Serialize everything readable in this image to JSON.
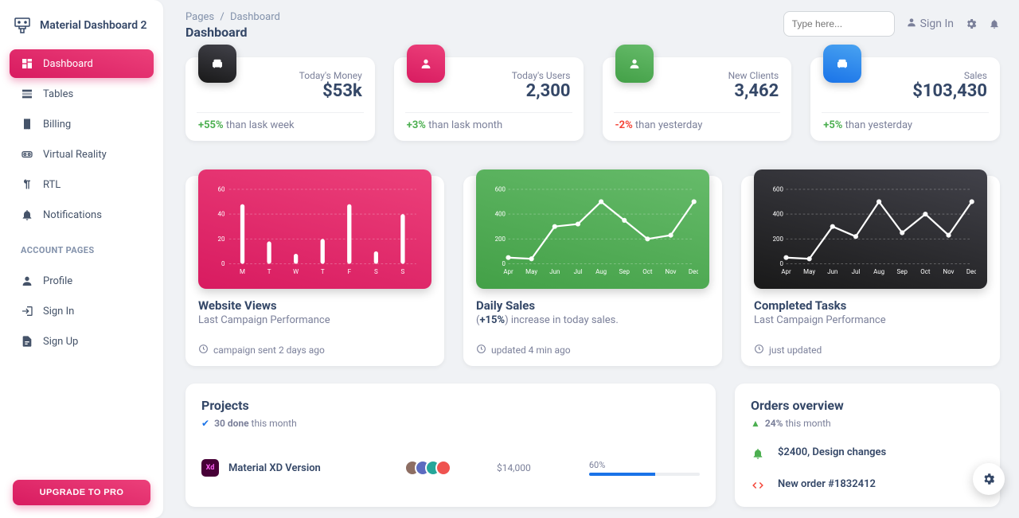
{
  "brand": "Material Dashboard 2",
  "nav": {
    "main": [
      {
        "label": "Dashboard",
        "icon": "dashboard",
        "active": true
      },
      {
        "label": "Tables",
        "icon": "table"
      },
      {
        "label": "Billing",
        "icon": "receipt"
      },
      {
        "label": "Virtual Reality",
        "icon": "vr"
      },
      {
        "label": "RTL",
        "icon": "rtl"
      },
      {
        "label": "Notifications",
        "icon": "bell"
      }
    ],
    "section_label": "ACCOUNT PAGES",
    "account": [
      {
        "label": "Profile",
        "icon": "person"
      },
      {
        "label": "Sign In",
        "icon": "login"
      },
      {
        "label": "Sign Up",
        "icon": "signup"
      }
    ],
    "upgrade_label": "UPGRADE TO PRO"
  },
  "header": {
    "breadcrumb_root": "Pages",
    "breadcrumb_current": "Dashboard",
    "title": "Dashboard",
    "search_placeholder": "Type here...",
    "signin_label": "Sign In"
  },
  "stats": [
    {
      "icon": "weekend",
      "color": "dark",
      "label": "Today's Money",
      "value": "$53k",
      "delta": "+55%",
      "delta_dir": "pos",
      "tail": " than lask week"
    },
    {
      "icon": "person",
      "color": "pink",
      "label": "Today's Users",
      "value": "2,300",
      "delta": "+3%",
      "delta_dir": "pos",
      "tail": " than lask month"
    },
    {
      "icon": "person",
      "color": "green",
      "label": "New Clients",
      "value": "3,462",
      "delta": "-2%",
      "delta_dir": "neg",
      "tail": " than yesterday"
    },
    {
      "icon": "weekend",
      "color": "blue",
      "label": "Sales",
      "value": "$103,430",
      "delta": "+5%",
      "delta_dir": "pos",
      "tail": " than yesterday"
    }
  ],
  "charts": [
    {
      "color": "pink",
      "title": "Website Views",
      "sub": "Last Campaign Performance",
      "foot": "campaign sent 2 days ago"
    },
    {
      "color": "green",
      "title": "Daily Sales",
      "sub_pre": "(",
      "sub_bold": "+15%",
      "sub_post": ") increase in today sales.",
      "foot": "updated 4 min ago"
    },
    {
      "color": "dark",
      "title": "Completed Tasks",
      "sub": "Last Campaign Performance",
      "foot": "just updated"
    }
  ],
  "projects": {
    "title": "Projects",
    "done_count": "30 done",
    "done_tail": " this month",
    "row": {
      "name": "Material XD Version",
      "budget": "$14,000",
      "pct": "60%",
      "pct_num": 60
    }
  },
  "orders": {
    "title": "Orders overview",
    "delta": "24%",
    "delta_tail": " this month",
    "items": [
      {
        "icon": "bell",
        "color": "green",
        "title": "$2400, Design changes"
      },
      {
        "icon": "code",
        "color": "red",
        "title": "New order #1832412"
      }
    ]
  },
  "chart_data": [
    {
      "type": "bar",
      "categories": [
        "M",
        "T",
        "W",
        "T",
        "F",
        "S",
        "S"
      ],
      "values": [
        48,
        18,
        8,
        20,
        48,
        10,
        40
      ],
      "ylim": [
        0,
        60
      ],
      "yticks": [
        0,
        20,
        40,
        60
      ],
      "title": "Website Views"
    },
    {
      "type": "line",
      "categories": [
        "Apr",
        "May",
        "Jun",
        "Jul",
        "Aug",
        "Sep",
        "Oct",
        "Nov",
        "Dec"
      ],
      "values": [
        50,
        40,
        300,
        320,
        500,
        350,
        200,
        230,
        500
      ],
      "ylim": [
        0,
        600
      ],
      "yticks": [
        0,
        200,
        400,
        600
      ],
      "title": "Daily Sales"
    },
    {
      "type": "line",
      "categories": [
        "Apr",
        "May",
        "Jun",
        "Jul",
        "Aug",
        "Sep",
        "Oct",
        "Nov",
        "Dec"
      ],
      "values": [
        50,
        40,
        300,
        220,
        500,
        250,
        400,
        230,
        500
      ],
      "ylim": [
        0,
        600
      ],
      "yticks": [
        0,
        200,
        400,
        600
      ],
      "title": "Completed Tasks"
    }
  ]
}
